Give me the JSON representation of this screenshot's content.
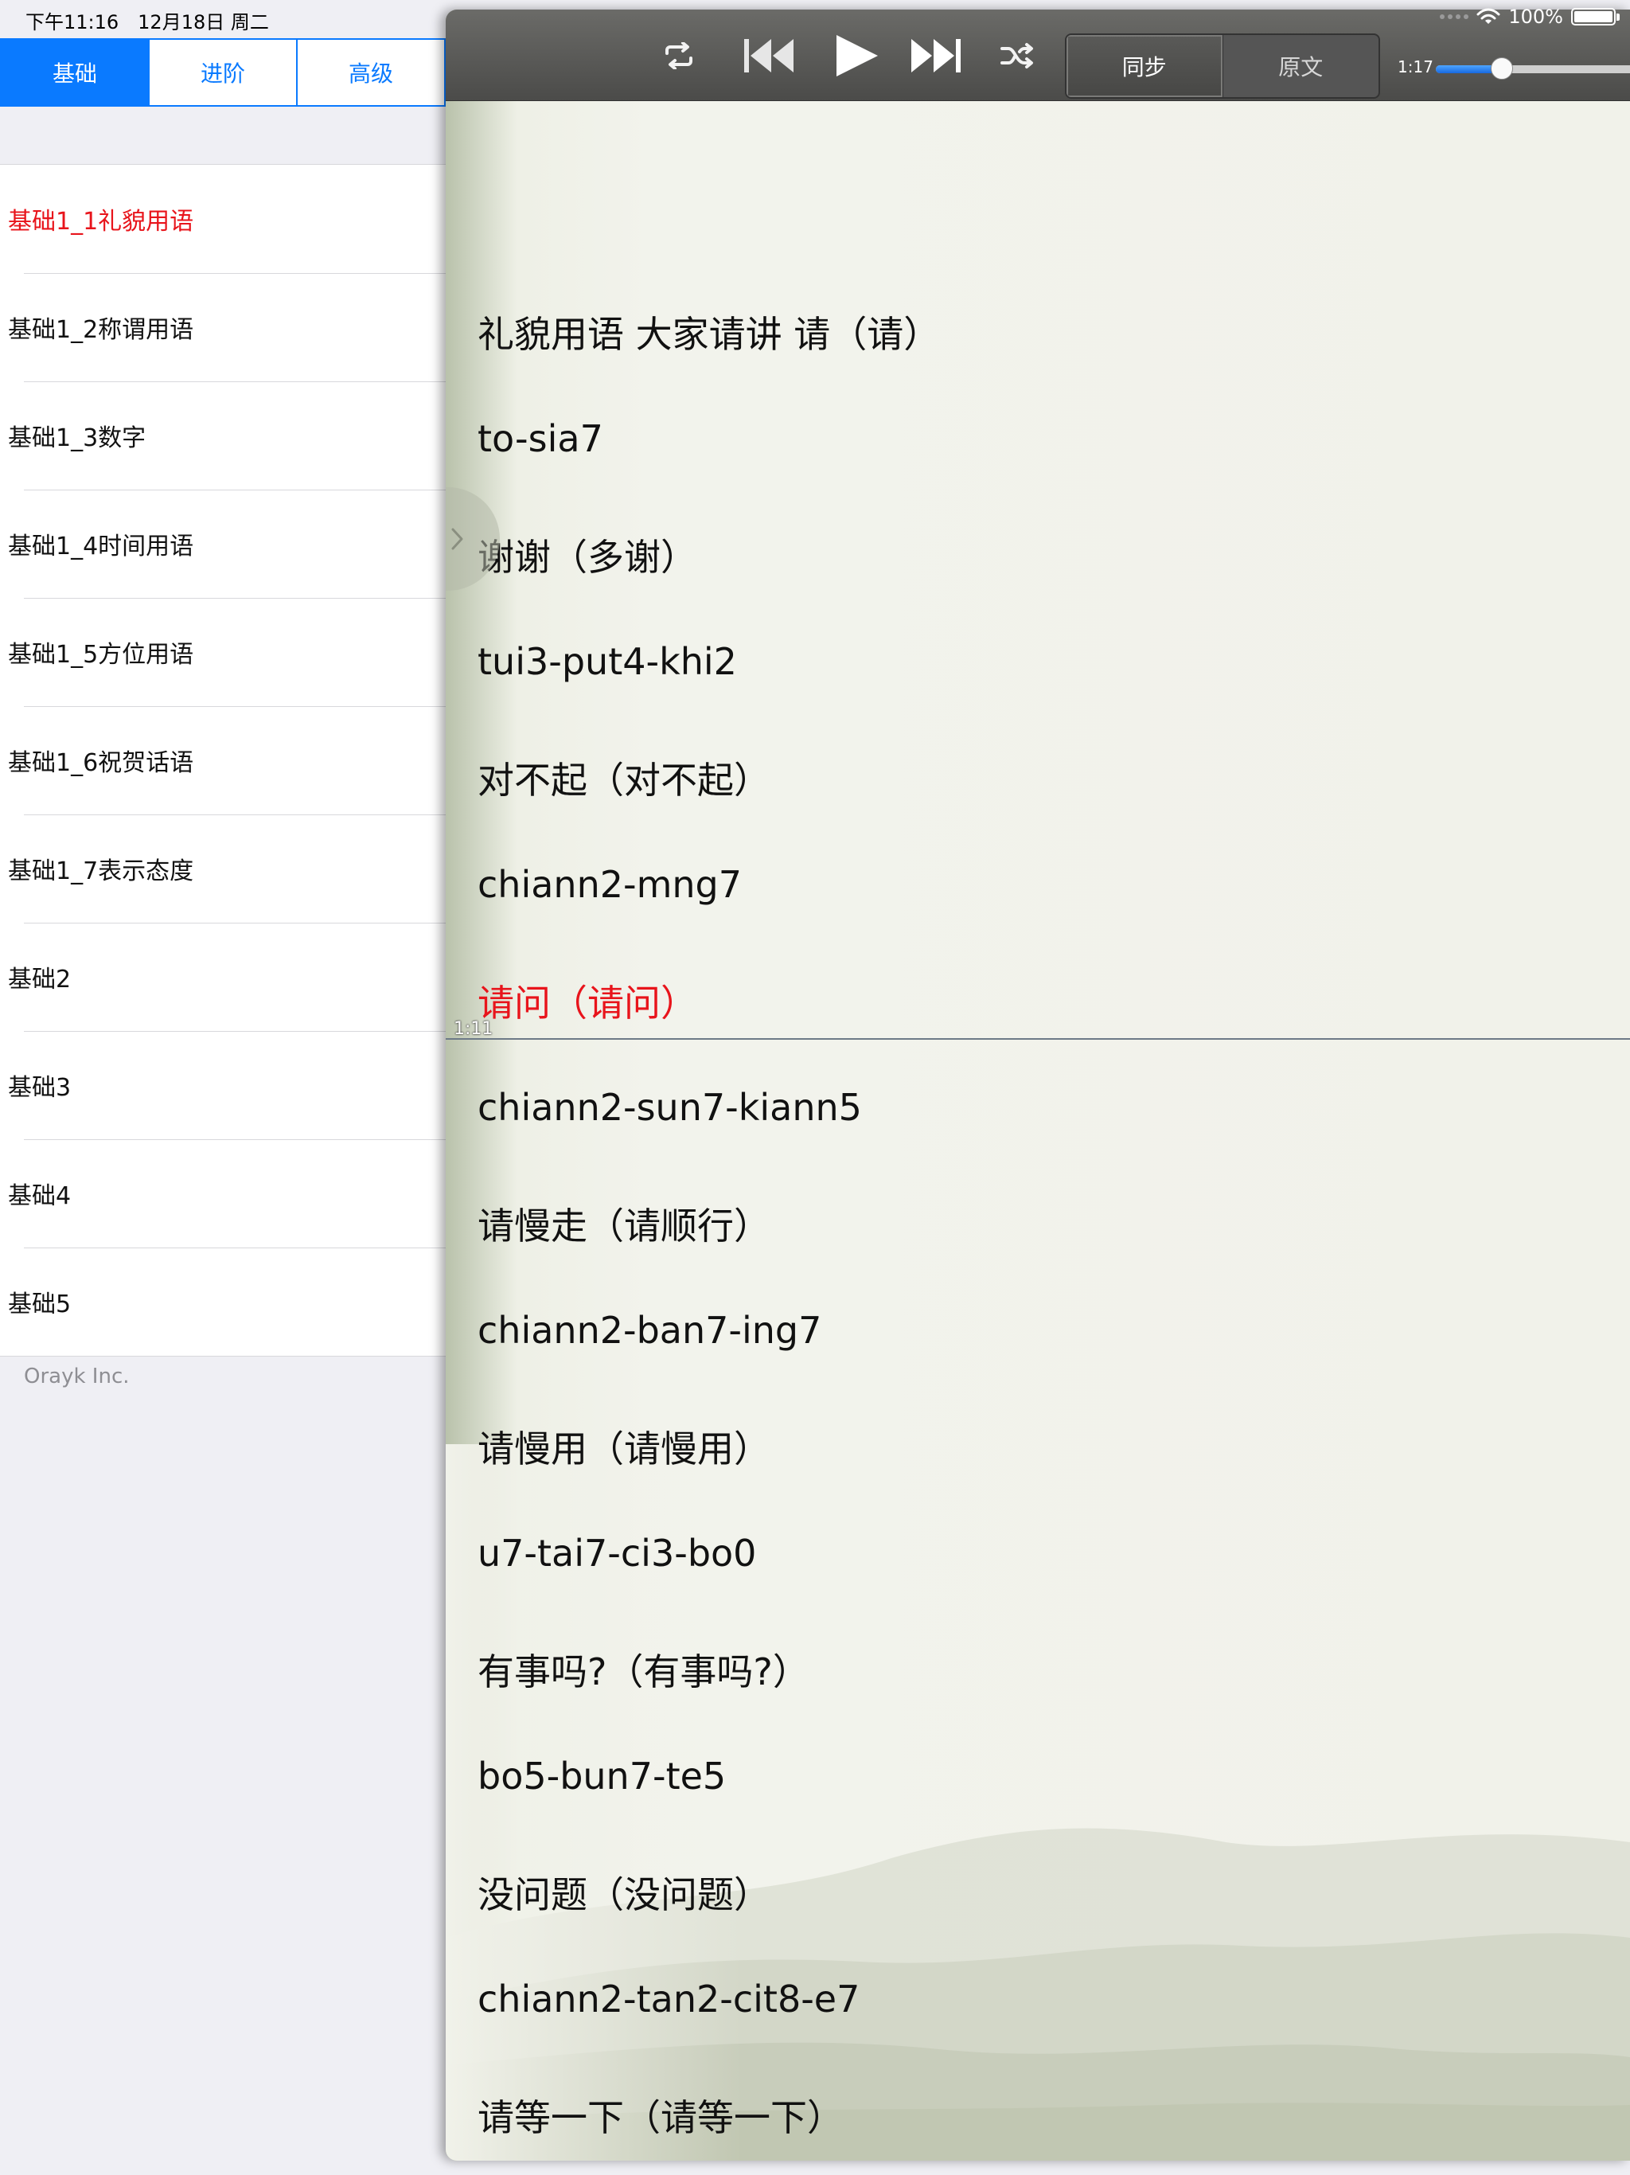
{
  "status_bar": {
    "time": "下午11:16　12月18日 周二",
    "battery_text": "100%",
    "battery_level": 1.0
  },
  "sidebar": {
    "tabs": [
      {
        "label": "基础",
        "active": true
      },
      {
        "label": "进阶",
        "active": false
      },
      {
        "label": "高级",
        "active": false
      }
    ],
    "items": [
      {
        "label": "基础1_1礼貌用语",
        "selected": true
      },
      {
        "label": "基础1_2称谓用语",
        "selected": false
      },
      {
        "label": "基础1_3数字",
        "selected": false
      },
      {
        "label": "基础1_4时间用语",
        "selected": false
      },
      {
        "label": "基础1_5方位用语",
        "selected": false
      },
      {
        "label": "基础1_6祝贺话语",
        "selected": false
      },
      {
        "label": "基础1_7表示态度",
        "selected": false
      },
      {
        "label": "基础2",
        "selected": false
      },
      {
        "label": "基础3",
        "selected": false
      },
      {
        "label": "基础4",
        "selected": false
      },
      {
        "label": "基础5",
        "selected": false
      }
    ],
    "footer": "Orayk Inc."
  },
  "player": {
    "controls": [
      "repeat-icon",
      "previous-icon",
      "play-icon",
      "next-icon",
      "shuffle-icon"
    ],
    "modes": [
      {
        "label": "同步",
        "active": true
      },
      {
        "label": "原文",
        "active": false
      }
    ],
    "elapsed": "1:17",
    "progress": 0.33,
    "accent_color": "#1769e0",
    "highlight_color": "#e8141b"
  },
  "lyrics": {
    "current_time": "1:11",
    "lines": [
      {
        "text": "礼貌用语 大家请讲  请（请）",
        "current": false
      },
      {
        "text": "to-sia7",
        "current": false
      },
      {
        "text": "谢谢（多谢）",
        "current": false
      },
      {
        "text": "tui3-put4-khi2",
        "current": false
      },
      {
        "text": "对不起（对不起）",
        "current": false
      },
      {
        "text": "chiann2-mng7",
        "current": false
      },
      {
        "text": "请问（请问）",
        "current": true
      },
      {
        "text": "chiann2-sun7-kiann5",
        "current": false
      },
      {
        "text": "请慢走（请顺行）",
        "current": false
      },
      {
        "text": "chiann2-ban7-ing7",
        "current": false
      },
      {
        "text": "请慢用（请慢用）",
        "current": false
      },
      {
        "text": "u7-tai7-ci3-bo0",
        "current": false
      },
      {
        "text": "有事吗?（有事吗?）",
        "current": false
      },
      {
        "text": "bo5-bun7-te5",
        "current": false
      },
      {
        "text": "没问题（没问题）",
        "current": false
      },
      {
        "text": "chiann2-tan2-cit8-e7",
        "current": false
      },
      {
        "text": "请等一下（请等一下）",
        "current": false
      }
    ]
  }
}
